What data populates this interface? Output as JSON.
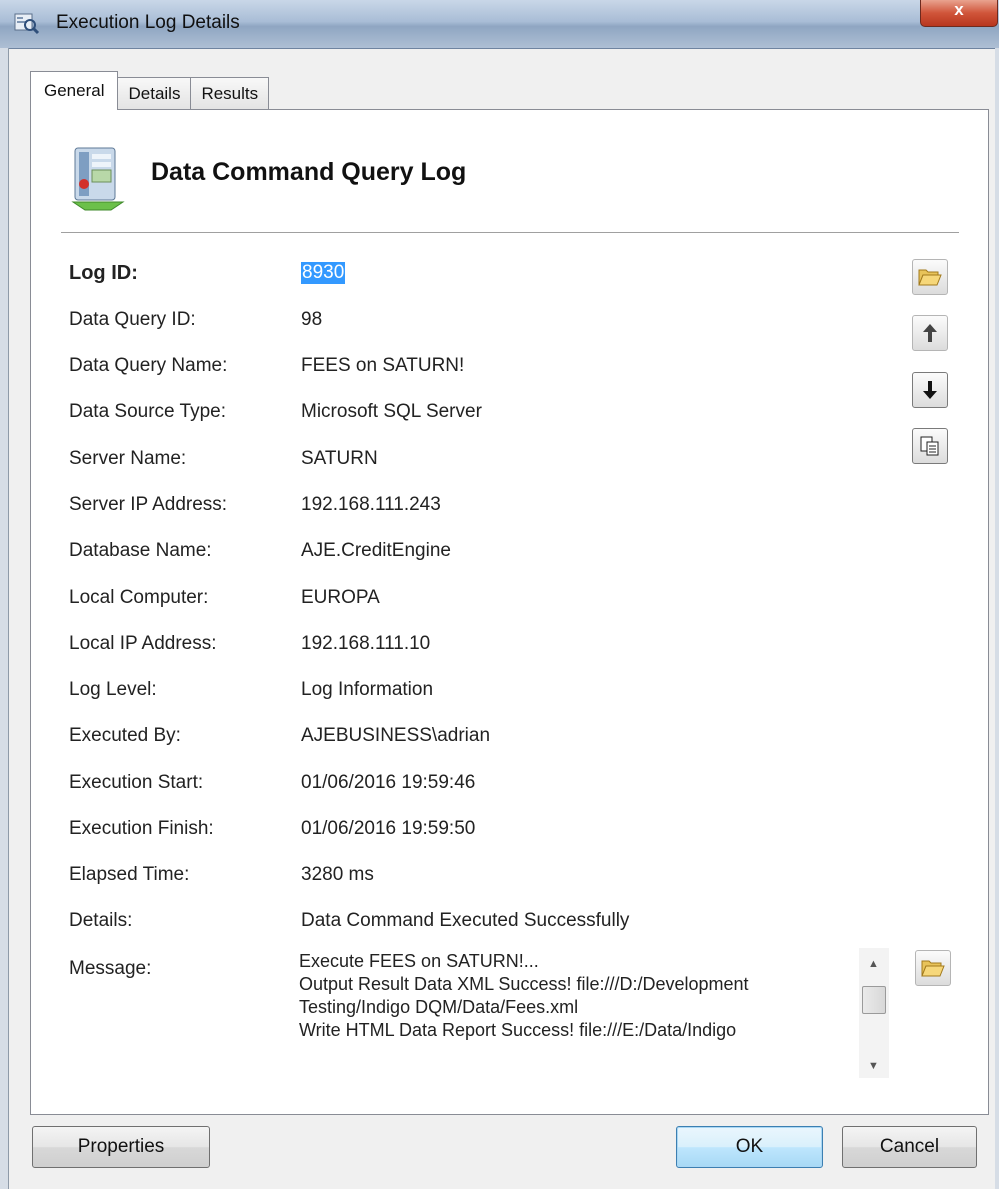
{
  "window": {
    "title": "Execution Log Details",
    "close_label": "x"
  },
  "tabs": [
    {
      "label": "General",
      "active": true
    },
    {
      "label": "Details",
      "active": false
    },
    {
      "label": "Results",
      "active": false
    }
  ],
  "header": {
    "title": "Data Command Query Log"
  },
  "fields": {
    "log_id": {
      "label": "Log ID:",
      "value": "8930"
    },
    "data_query_id": {
      "label": "Data Query ID:",
      "value": "98"
    },
    "data_query_name": {
      "label": "Data Query Name:",
      "value": "FEES on SATURN!"
    },
    "data_source_type": {
      "label": "Data Source Type:",
      "value": "Microsoft SQL Server"
    },
    "server_name": {
      "label": "Server Name:",
      "value": "SATURN"
    },
    "server_ip": {
      "label": "Server IP Address:",
      "value": "192.168.111.243"
    },
    "database_name": {
      "label": "Database Name:",
      "value": "AJE.CreditEngine"
    },
    "local_computer": {
      "label": "Local Computer:",
      "value": "EUROPA"
    },
    "local_ip": {
      "label": "Local IP Address:",
      "value": "192.168.111.10"
    },
    "log_level": {
      "label": "Log Level:",
      "value": "Log Information"
    },
    "executed_by": {
      "label": "Executed By:",
      "value": "AJEBUSINESS\\adrian"
    },
    "execution_start": {
      "label": "Execution Start:",
      "value": "01/06/2016 19:59:46"
    },
    "execution_finish": {
      "label": "Execution Finish:",
      "value": "01/06/2016 19:59:50"
    },
    "elapsed_time": {
      "label": "Elapsed Time:",
      "value": "3280 ms"
    },
    "details": {
      "label": "Details:",
      "value": "Data Command Executed Successfully"
    },
    "message": {
      "label": "Message:",
      "lines": [
        "Execute FEES on SATURN!...",
        "Output Result Data XML Success! file:///D:/Development",
        "Testing/Indigo DQM/Data/Fees.xml",
        "Write HTML Data Report Success! file:///E:/Data/Indigo"
      ]
    }
  },
  "buttons": {
    "properties": "Properties",
    "ok": "OK",
    "cancel": "Cancel"
  },
  "icons": {
    "open_folder": "folder-open-icon",
    "up": "arrow-up-icon",
    "down": "arrow-down-icon",
    "copy": "copy-icon"
  }
}
